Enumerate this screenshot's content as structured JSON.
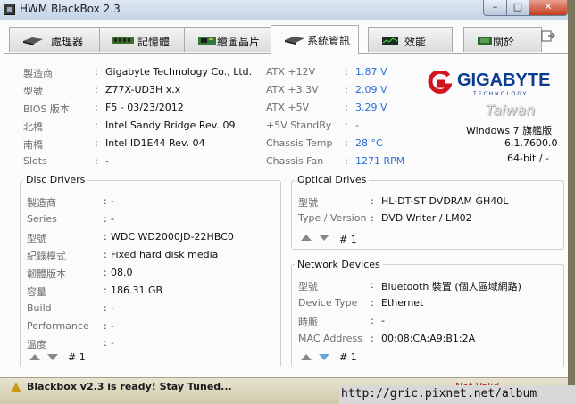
{
  "window": {
    "title": "HWM BlackBox 2.3",
    "close_label": "✕",
    "min_label": "–",
    "max_label": "□"
  },
  "tabs": [
    {
      "label": "處理器",
      "icon": "cpu-icon"
    },
    {
      "label": "記憶體",
      "icon": "memory-icon"
    },
    {
      "label": "繪圖晶片",
      "icon": "graphics-card-icon"
    },
    {
      "label": "系統資訊",
      "icon": "system-info-icon",
      "active": true
    },
    {
      "label": "效能",
      "icon": "performance-icon"
    },
    {
      "label": "關於",
      "icon": "about-icon"
    }
  ],
  "system": {
    "left": [
      {
        "label": "製造商",
        "value": "Gigabyte Technology Co., Ltd."
      },
      {
        "label": "型號",
        "value": "Z77X-UD3H x.x"
      },
      {
        "label": "BIOS 版本",
        "value": "F5 - 03/23/2012"
      },
      {
        "label": "北橋",
        "value": "Intel Sandy Bridge Rev. 09"
      },
      {
        "label": "南橋",
        "value": "Intel ID1E44 Rev. 04"
      },
      {
        "label": "Slots",
        "value": "-"
      }
    ],
    "middle": [
      {
        "label": "ATX +12V",
        "value": "1.87 V"
      },
      {
        "label": "ATX +3.3V",
        "value": "2.09 V"
      },
      {
        "label": "ATX +5V",
        "value": "3.29 V"
      },
      {
        "label": "+5V StandBy",
        "value": "-"
      },
      {
        "label": "Chassis Temp",
        "value": "28 °C"
      },
      {
        "label": "Chassis  Fan",
        "value": "1271 RPM"
      }
    ],
    "logo": {
      "brand": "GIGABYTE",
      "tagline": "TECHNOLOGY",
      "region": "Taiwan"
    },
    "os": {
      "name": "Windows 7 旗艦版",
      "version": "6.1.7600.0",
      "arch": "64-bit / -"
    }
  },
  "disc": {
    "title": "Disc Drivers",
    "rows": [
      {
        "label": "製造商",
        "value": "-"
      },
      {
        "label": "Series",
        "value": "-"
      },
      {
        "label": "型號",
        "value": "WDC WD2000JD-22HBC0"
      },
      {
        "label": "紀錄模式",
        "value": "Fixed hard disk media"
      },
      {
        "label": "韌體版本",
        "value": "08.0"
      },
      {
        "label": "容量",
        "value": "186.31 GB"
      },
      {
        "label": "Build",
        "value": "-"
      },
      {
        "label": "Performance",
        "value": "-"
      },
      {
        "label": "溫度",
        "value": "-"
      }
    ],
    "nav": "# 1"
  },
  "optical": {
    "title": "Optical Drives",
    "rows": [
      {
        "label": "型號",
        "value": "HL-DT-ST DVDRAM GH40L"
      },
      {
        "label": "Type / Version",
        "value": "DVD Writer / LM02"
      }
    ],
    "nav": "# 1"
  },
  "network": {
    "title": "Network Devices",
    "rows": [
      {
        "label": "型號",
        "value": "Bluetooth 裝置 (個人區域網路)"
      },
      {
        "label": "Device Type",
        "value": "Ethernet"
      },
      {
        "label": "時脈",
        "value": "-"
      },
      {
        "label": "MAC Address",
        "value": "00:08:CA:A9:B1:2A"
      }
    ],
    "nav": "# 1"
  },
  "statusbar": {
    "text": "Blackbox v2.3 is ready! Stay Tuned...",
    "right": "Not Valid"
  },
  "watermark": {
    "url": "http://gric.pixnet.net/album"
  },
  "colors": {
    "accent_blue": "#2a6ed0",
    "brand_blue": "#0a3b8f",
    "brand_red": "#d2141e"
  }
}
